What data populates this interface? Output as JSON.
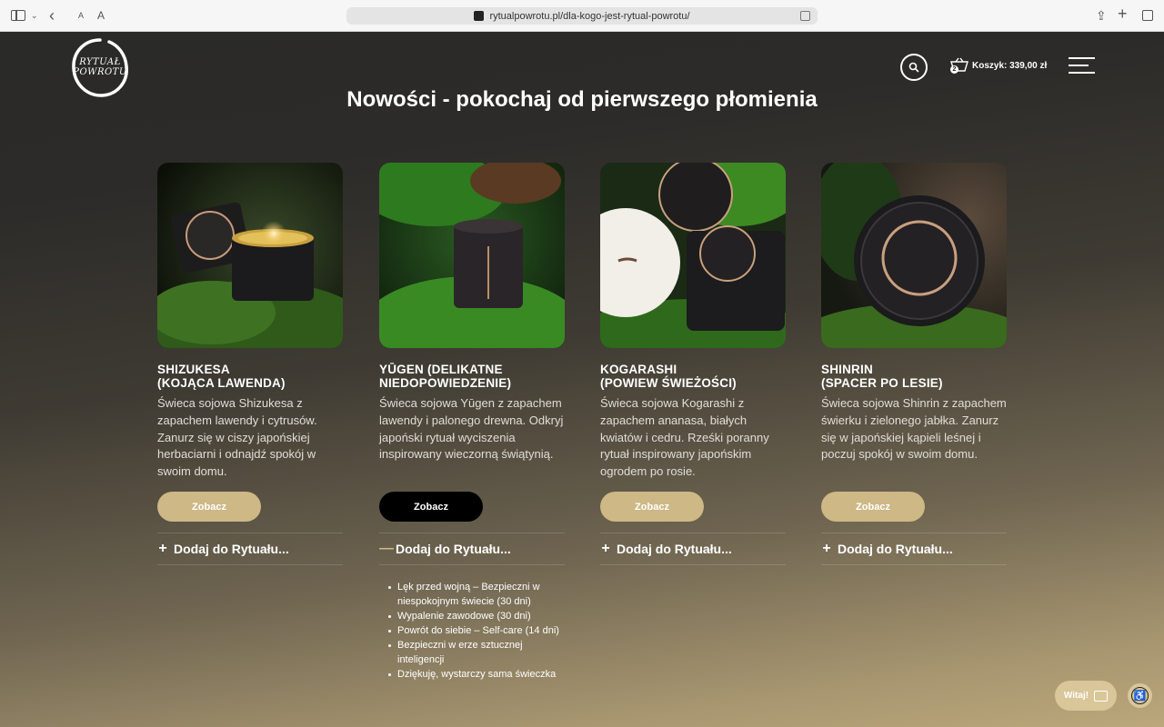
{
  "browser": {
    "url": "rytualpowrotu.pl/dla-kogo-jest-rytual-powrotu/",
    "aa_small": "A",
    "aa_big": "A"
  },
  "header": {
    "logo_line1": "RYTUAŁ",
    "logo_line2": "POWROTU",
    "cart_label": "Koszyk: 339,00 zł",
    "cart_count": "2"
  },
  "headline": "Nowości - pokochaj od pierwszego płomienia",
  "products": [
    {
      "title_line1": "SHIZUKESA",
      "title_line2": "(KOJĄCA LAWENDA)",
      "desc": "Świeca sojowa Shizukesa z zapachem lawendy i cytrusów. Zanurz się w ciszy japońskiej herbaciarni i odnajdź spokój w swoim domu.",
      "button": "Zobacz",
      "add_label": "Dodaj do Rytuału...",
      "add_sign": "+"
    },
    {
      "title_line1": "YŪGEN (DELIKATNE",
      "title_line2": "NIEDOPOWIEDZENIE)",
      "desc": "Świeca sojowa Yūgen z zapachem lawendy i palonego drewna. Odkryj japoński rytuał wyciszenia inspirowany wieczorną świątynią.",
      "button": "Zobacz",
      "add_label": "Dodaj do Rytuału...",
      "add_sign": "—"
    },
    {
      "title_line1": "KOGARASHI",
      "title_line2": "(POWIEW ŚWIEŻOŚCI)",
      "desc": "Świeca sojowa Kogarashi z zapachem ananasa, białych kwiatów i cedru. Rześki poranny rytuał inspirowany japońskim ogrodem po rosie.",
      "button": "Zobacz",
      "add_label": "Dodaj do Rytuału...",
      "add_sign": "+"
    },
    {
      "title_line1": "SHINRIN",
      "title_line2": "(SPACER PO LESIE)",
      "desc": "Świeca sojowa Shinrin z zapachem świerku i zielonego jabłka. Zanurz się w japońskiej kąpieli leśnej i poczuj spokój w swoim domu.",
      "button": "Zobacz",
      "add_label": "Dodaj do Rytuału...",
      "add_sign": "+"
    }
  ],
  "rituals": [
    "Lęk przed wojną – Bezpieczni w niespokojnym świecie (30 dni)",
    "Wypalenie zawodowe (30 dni)",
    "Powrót do siebie – Self-care (14 dni)",
    "Bezpieczni w erze sztucznej inteligencji",
    "Dziękuję, wystarczy sama świeczka"
  ],
  "chat_label": "Witaj!",
  "colors": {
    "accent": "#cdb886",
    "dark_button": "#000000"
  }
}
